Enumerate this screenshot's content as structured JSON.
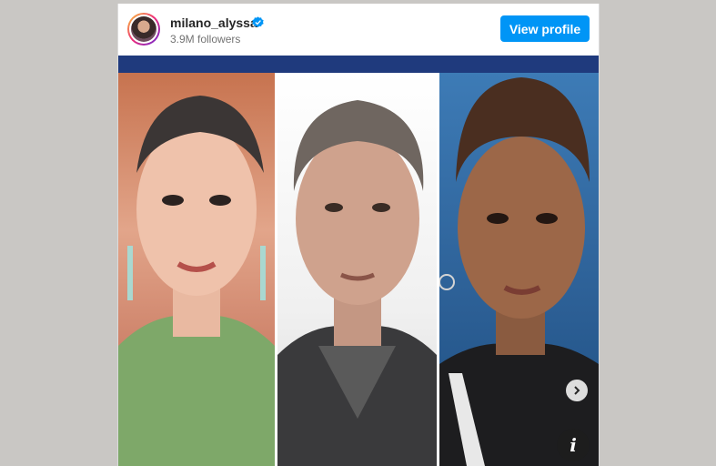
{
  "profile": {
    "username": "milano_alyssa",
    "followers": "3.9M followers",
    "avatar_icon": "avatar-image",
    "verified_icon": "verified-badge-icon",
    "verified_color": "#0095f6"
  },
  "actions": {
    "view_profile_label": "View profile",
    "view_profile_color": "#0095f6"
  },
  "post": {
    "images": [
      "actor-portrait-1",
      "actor-portrait-2",
      "actor-portrait-3"
    ],
    "next_icon": "chevron-right-icon",
    "info_icon": "info-icon",
    "info_glyph": "i"
  }
}
